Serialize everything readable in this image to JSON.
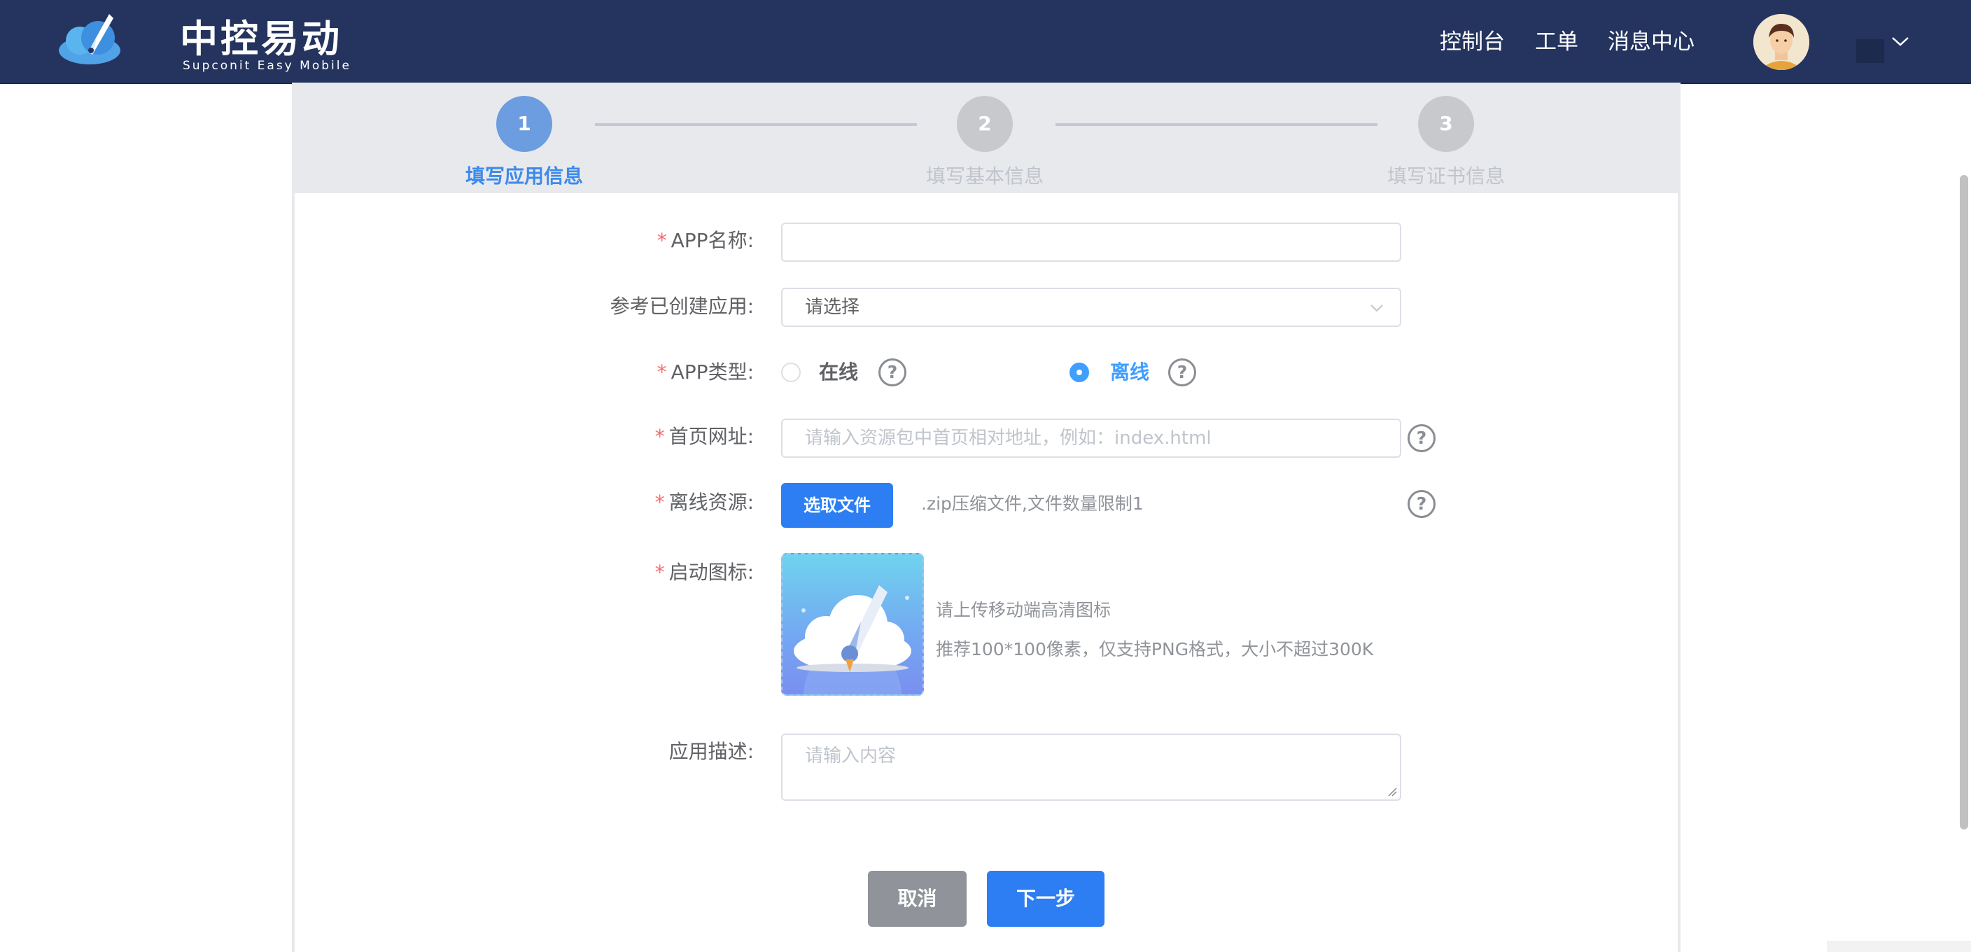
{
  "header": {
    "brand": {
      "title": "中控易动",
      "subtitle": "Supconit Easy Mobile"
    },
    "nav": [
      {
        "label": "控制台"
      },
      {
        "label": "工单"
      },
      {
        "label": "消息中心"
      }
    ],
    "icons": [
      "logo-rocket-cloud-icon",
      "avatar",
      "chevron-down-icon"
    ]
  },
  "steps": [
    {
      "number": "1",
      "label": "填写应用信息",
      "state": "active"
    },
    {
      "number": "2",
      "label": "填写基本信息",
      "state": "pending"
    },
    {
      "number": "3",
      "label": "填写证书信息",
      "state": "pending"
    }
  ],
  "form": {
    "app_name": {
      "label": "APP名称:",
      "required": true,
      "value": ""
    },
    "reference_app": {
      "label": "参考已创建应用:",
      "required": false,
      "value": "请选择"
    },
    "app_type": {
      "label": "APP类型:",
      "required": true,
      "options": [
        {
          "label": "在线",
          "checked": false
        },
        {
          "label": "离线",
          "checked": true
        }
      ]
    },
    "homepage_url": {
      "label": "首页网址:",
      "required": true,
      "placeholder": "请输入资源包中首页相对地址，例如：index.html"
    },
    "offline_resource": {
      "label": "离线资源:",
      "required": true,
      "button": "选取文件",
      "hint": ".zip压缩文件,文件数量限制1"
    },
    "launch_icon": {
      "label": "启动图标:",
      "required": true,
      "tip1": "请上传移动端高清图标",
      "tip2": "推荐100*100像素，仅支持PNG格式，大小不超过300K"
    },
    "description": {
      "label": "应用描述:",
      "required": false,
      "placeholder": "请输入内容"
    },
    "required_mark": "*"
  },
  "actions": {
    "cancel": "取消",
    "next": "下一步"
  },
  "help_glyph": "?",
  "colors": {
    "header_bg": "#24345f",
    "primary": "#2c7ef2",
    "active_step": "#6b9de0",
    "required": "#f56c6c",
    "cancel_bg": "#909399"
  }
}
